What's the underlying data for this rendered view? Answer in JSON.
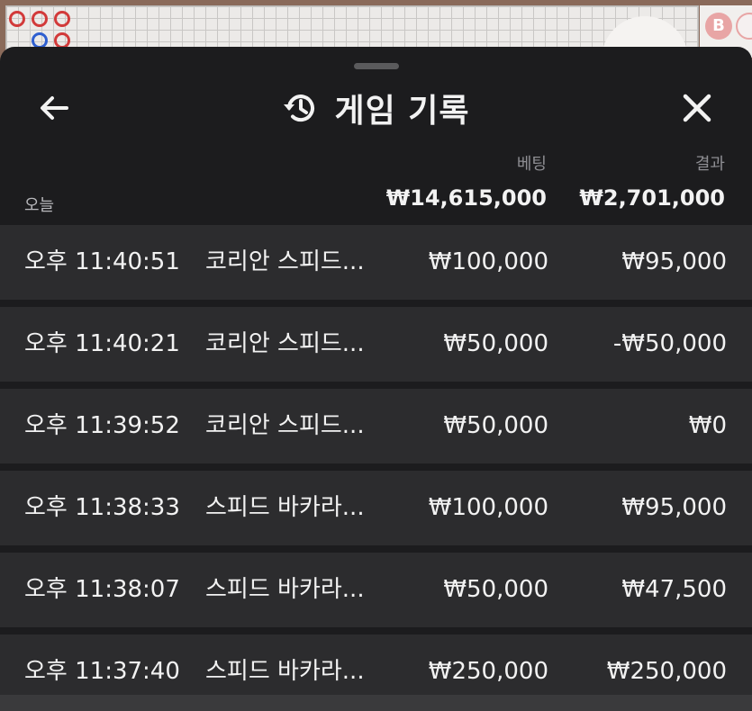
{
  "header": {
    "title": "게임 기록",
    "back_icon": "arrow-left-icon",
    "history_icon": "history-icon",
    "close_icon": "close-icon"
  },
  "columns": {
    "bet_label": "베팅",
    "result_label": "결과"
  },
  "summary": {
    "date_label": "오늘",
    "total_bet": "₩14,615,000",
    "total_result": "₩2,701,000"
  },
  "background": {
    "badge_label": "B"
  },
  "rows": [
    {
      "time": "오후 11:40:51",
      "game": "코리안 스피드...",
      "bet": "₩100,000",
      "result": "₩95,000"
    },
    {
      "time": "오후 11:40:21",
      "game": "코리안 스피드...",
      "bet": "₩50,000",
      "result": "-₩50,000"
    },
    {
      "time": "오후 11:39:52",
      "game": "코리안 스피드...",
      "bet": "₩50,000",
      "result": "₩0"
    },
    {
      "time": "오후 11:38:33",
      "game": "스피드 바카라...",
      "bet": "₩100,000",
      "result": "₩95,000"
    },
    {
      "time": "오후 11:38:07",
      "game": "스피드 바카라...",
      "bet": "₩50,000",
      "result": "₩47,500"
    },
    {
      "time": "오후 11:37:40",
      "game": "스피드 바카라...",
      "bet": "₩250,000",
      "result": "₩250,000"
    }
  ],
  "colors": {
    "sheet_bg": "#1c1c1e",
    "row_bg": "#2c2c2e",
    "text": "#f2f2f2",
    "muted": "#8e8e93"
  }
}
